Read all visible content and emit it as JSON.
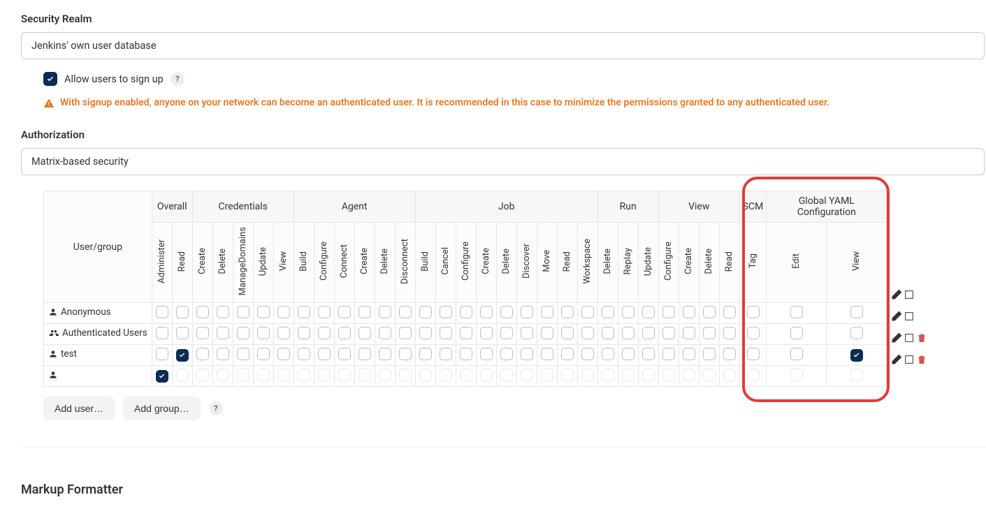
{
  "securityRealm": {
    "title": "Security Realm",
    "value": "Jenkins' own user database",
    "signup": {
      "label": "Allow users to sign up",
      "checked": true,
      "warning": "With signup enabled, anyone on your network can become an authenticated user. It is recommended in this case to minimize the permissions granted to any authenticated user."
    }
  },
  "authorization": {
    "title": "Authorization",
    "value": "Matrix-based security"
  },
  "matrix": {
    "userGroupHeader": "User/group",
    "groups": [
      {
        "name": "Overall",
        "cols": [
          "Administer",
          "Read"
        ]
      },
      {
        "name": "Credentials",
        "cols": [
          "Create",
          "Delete",
          "ManageDomains",
          "Update",
          "View"
        ]
      },
      {
        "name": "Agent",
        "cols": [
          "Build",
          "Configure",
          "Connect",
          "Create",
          "Delete",
          "Disconnect"
        ]
      },
      {
        "name": "Job",
        "cols": [
          "Build",
          "Cancel",
          "Configure",
          "Create",
          "Delete",
          "Discover",
          "Move",
          "Read",
          "Workspace"
        ]
      },
      {
        "name": "Run",
        "cols": [
          "Delete",
          "Replay",
          "Update"
        ]
      },
      {
        "name": "View",
        "cols": [
          "Configure",
          "Create",
          "Delete",
          "Read"
        ]
      },
      {
        "name": "SCM",
        "cols": [
          "Tag"
        ]
      },
      {
        "name": "Global YAML Configuration",
        "cols": [
          "Edit",
          "View"
        ]
      }
    ],
    "rows": [
      {
        "kind": "user",
        "label": "Anonymous",
        "checked": [],
        "deletable": false,
        "dim": false
      },
      {
        "kind": "group",
        "label": "Authenticated Users",
        "checked": [],
        "deletable": false,
        "dim": false
      },
      {
        "kind": "user",
        "label": "test",
        "checked": [
          1,
          31
        ],
        "deletable": true,
        "dim": false
      },
      {
        "kind": "user",
        "label": "",
        "checked": [
          0
        ],
        "deletable": true,
        "dim": true
      }
    ]
  },
  "buttons": {
    "addUser": "Add user…",
    "addGroup": "Add group…"
  },
  "markupFormatter": {
    "title": "Markup Formatter"
  }
}
